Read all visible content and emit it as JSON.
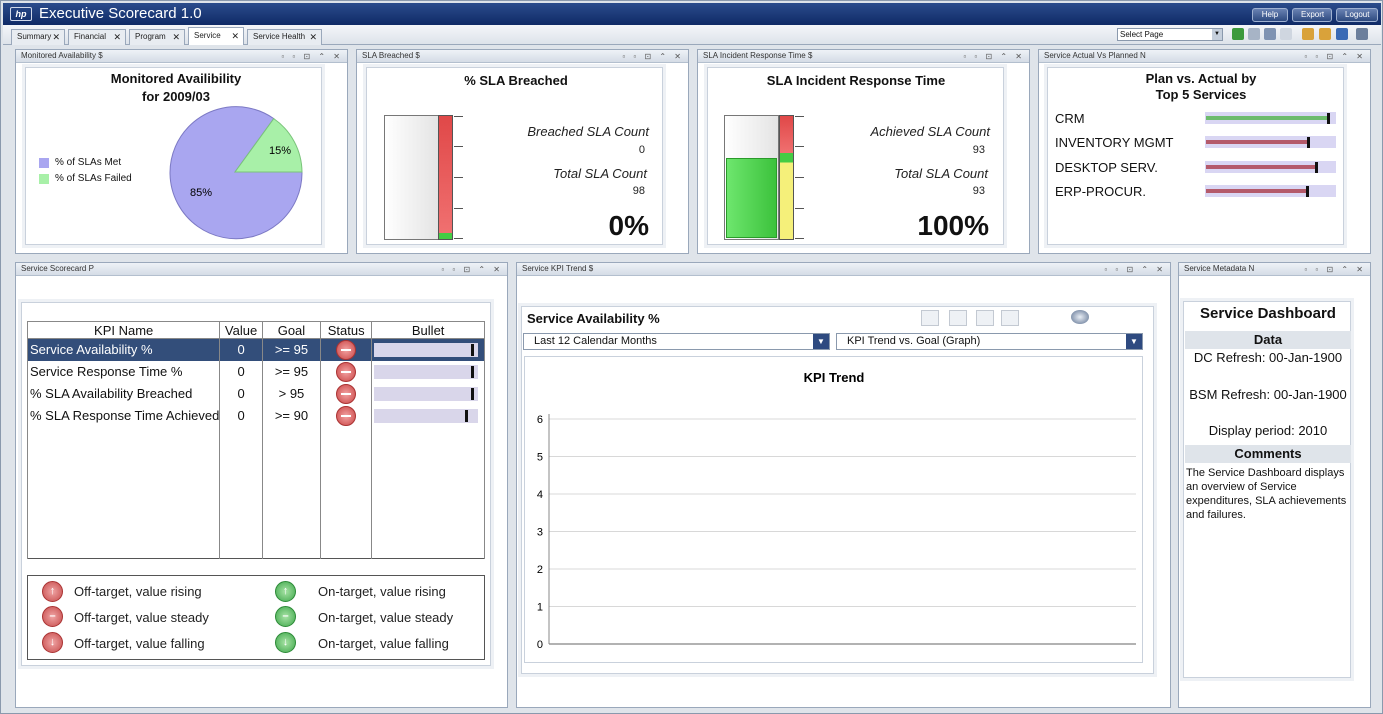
{
  "app": {
    "title": "Executive Scorecard 1.0",
    "help": "Help",
    "export": "Export",
    "logout": "Logout"
  },
  "tabs": [
    {
      "label": "Summary"
    },
    {
      "label": "Financial"
    },
    {
      "label": "Program"
    },
    {
      "label": "Service",
      "active": true
    },
    {
      "label": "Service Health"
    }
  ],
  "select_page": "Select Page",
  "panels": {
    "availability": {
      "header": "Monitored Availability $",
      "title_line1": "Monitored Availibility",
      "title_line2": "for 2009/03",
      "legend": [
        {
          "label": "% of SLAs Met",
          "color": "#a9a6f0"
        },
        {
          "label": "% of SLAs Failed",
          "color": "#a8f0a8"
        }
      ],
      "slices": [
        {
          "label": "85%",
          "value": 85
        },
        {
          "label": "15%",
          "value": 15
        }
      ]
    },
    "breached": {
      "header": "SLA Breached $",
      "title": "% SLA Breached",
      "count_label": "Breached SLA Count",
      "count_value": "0",
      "total_label": "Total SLA Count",
      "total_value": "98",
      "percent": "0%",
      "fill_fraction": 0
    },
    "response": {
      "header": "SLA Incident Response Time $",
      "title": "SLA Incident Response Time",
      "count_label": "Achieved SLA Count",
      "count_value": "93",
      "total_label": "Total SLA Count",
      "total_value": "93",
      "percent": "100%",
      "fill_fraction": 1
    },
    "plan": {
      "header": "Service Actual Vs Planned N",
      "title_line1": "Plan vs. Actual by",
      "title_line2": "Top 5 Services",
      "items": [
        {
          "label": "CRM",
          "actual": 0.95,
          "color": "#6dbb6d"
        },
        {
          "label": "INVENTORY MGMT",
          "actual": 0.8,
          "color": "#b45a6b"
        },
        {
          "label": "DESKTOP SERV.",
          "actual": 0.86,
          "color": "#b45a6b"
        },
        {
          "label": "ERP-PROCUR.",
          "actual": 0.79,
          "color": "#b45a6b"
        }
      ]
    },
    "scorecard": {
      "header": "Service Scorecard P",
      "columns": [
        "KPI Name",
        "Value",
        "Goal",
        "Status",
        "Bullet"
      ],
      "rows": [
        {
          "name": "Service Availability %",
          "value": "0",
          "goal": ">= 95",
          "bullet": 0.97
        },
        {
          "name": "Service Response Time %",
          "value": "0",
          "goal": ">= 95",
          "bullet": 0.97
        },
        {
          "name": "% SLA Availability Breached",
          "value": "0",
          "goal": "> 95",
          "bullet": 0.97
        },
        {
          "name": "% SLA Response Time Achieved",
          "value": "0",
          "goal": ">= 90",
          "bullet": 0.91
        }
      ],
      "legend": [
        "Off-target, value rising",
        "Off-target, value steady",
        "Off-target, value falling",
        "On-target, value rising",
        "On-target, value steady",
        "On-target, value falling"
      ]
    },
    "trend": {
      "header": "Service KPI Trend $",
      "title": "Service Availability %",
      "range": "Last 12 Calendar Months",
      "mode": "KPI Trend vs. Goal (Graph)",
      "chart_title": "KPI Trend"
    },
    "meta": {
      "header": "Service Metadata N",
      "title": "Service Dashboard",
      "data_head": "Data",
      "dc": "DC Refresh: 00-Jan-1900",
      "bsm": "BSM Refresh: 00-Jan-1900",
      "period": "Display period: 2010",
      "comments_head": "Comments",
      "comments": "The Service Dashboard displays an overview of Service expenditures, SLA achievements and failures."
    }
  },
  "chart_data": {
    "type": "line",
    "title": "KPI Trend",
    "xlabel": "",
    "ylabel": "",
    "ylim": [
      0,
      6
    ],
    "yticks": [
      0,
      1,
      2,
      3,
      4,
      5,
      6
    ],
    "series": []
  }
}
